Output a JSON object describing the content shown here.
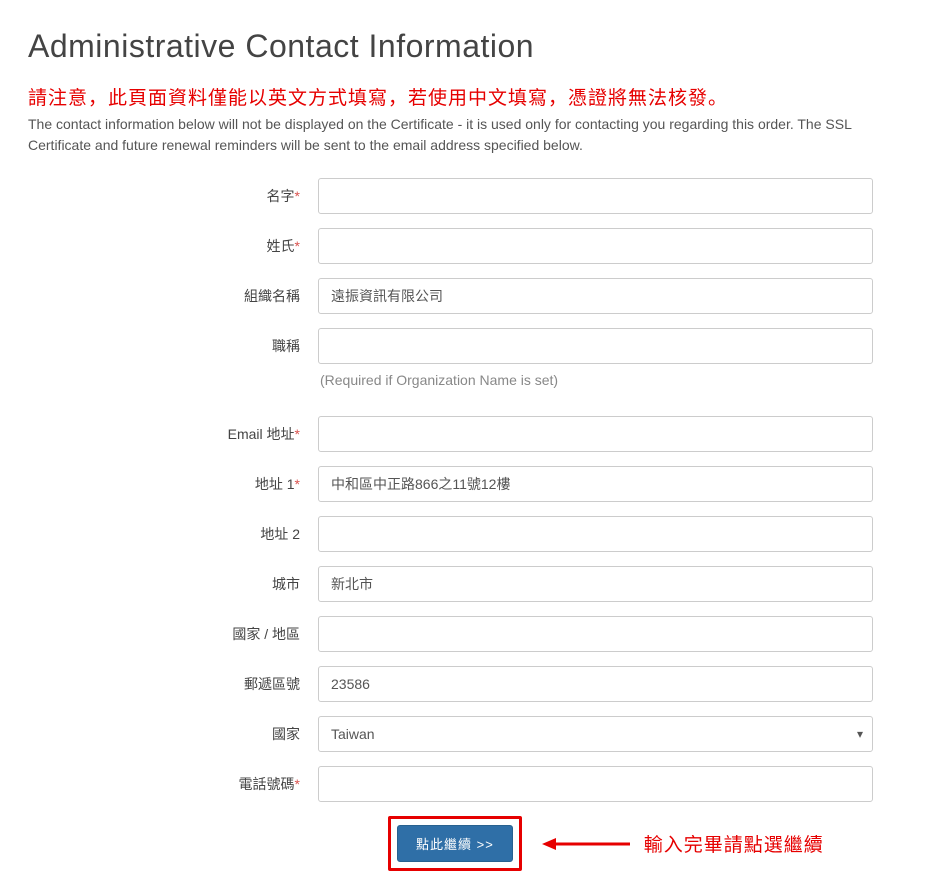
{
  "title": "Administrative Contact Information",
  "warning": "請注意，此頁面資料僅能以英文方式填寫，若使用中文填寫，憑證將無法核發。",
  "description": "The contact information below will not be displayed on the Certificate - it is used only for contacting you regarding this order. The SSL Certificate and future renewal reminders will be sent to the email address specified below.",
  "labels": {
    "first_name": "名字",
    "last_name": "姓氏",
    "org_name": "組織名稱",
    "job_title": "職稱",
    "email": "Email 地址",
    "address1": "地址 1",
    "address2": "地址 2",
    "city": "城市",
    "region": "國家 / 地區",
    "postal": "郵遞區號",
    "country": "國家",
    "phone": "電話號碼"
  },
  "hint_org": "(Required if Organization Name is set)",
  "values": {
    "first_name": "",
    "last_name": "",
    "org_name": "遠振資訊有限公司",
    "job_title": "",
    "email": "",
    "address1": "中和區中正路866之11號12樓",
    "address2": "",
    "city": "新北市",
    "region": "",
    "postal": "23586",
    "country": "Taiwan",
    "phone": ""
  },
  "submit_label": "點此繼續 >>",
  "cta_text": "輸入完畢請點選繼續",
  "required_mark": "*"
}
